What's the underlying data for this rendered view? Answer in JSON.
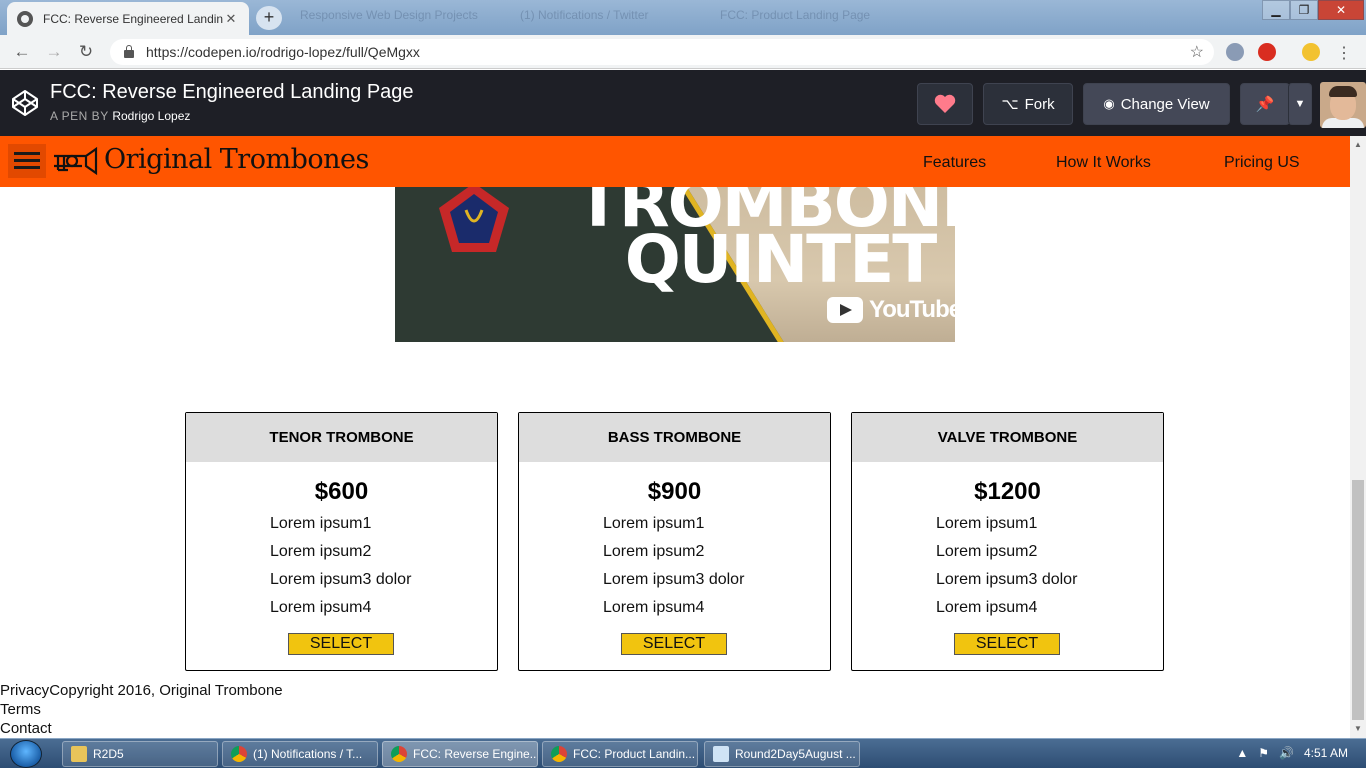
{
  "browser": {
    "active_tab_title": "FCC: Reverse Engineered Landing",
    "faded_tab_1": "Responsive Web Design Projects",
    "faded_tab_2": "(1) Notifications / Twitter",
    "faded_tab_3": "FCC: Product Landing Page",
    "url": "https://codepen.io/rodrigo-lopez/full/QeMgxx"
  },
  "codepen": {
    "pen_title": "FCC: Reverse Engineered Landing Page",
    "by_prefix": "A PEN BY",
    "author": "Rodrigo Lopez",
    "fork_label": "Fork",
    "change_view_label": "Change View"
  },
  "site": {
    "brand": "Original Trombones",
    "nav": [
      "Features",
      "How It Works",
      "Pricing US"
    ],
    "video": {
      "title_line1": "TROMBONE",
      "title_line2": "QUINTET",
      "platform": "YouTube"
    }
  },
  "pricing": [
    {
      "name": "TENOR TROMBONE",
      "price": "$600",
      "features": [
        "Lorem ipsum1",
        "Lorem ipsum2",
        "Lorem ipsum3 dolor",
        "Lorem ipsum4"
      ],
      "button": "SELECT"
    },
    {
      "name": "BASS TROMBONE",
      "price": "$900",
      "features": [
        "Lorem ipsum1",
        "Lorem ipsum2",
        "Lorem ipsum3 dolor",
        "Lorem ipsum4"
      ],
      "button": "SELECT"
    },
    {
      "name": "VALVE TROMBONE",
      "price": "$1200",
      "features": [
        "Lorem ipsum1",
        "Lorem ipsum2",
        "Lorem ipsum3 dolor",
        "Lorem ipsum4"
      ],
      "button": "SELECT"
    }
  ],
  "footer": {
    "privacy": "Privacy",
    "copyright": "Copyright 2016, Original Trombone",
    "terms": "Terms",
    "contact": "Contact"
  },
  "taskbar": {
    "items": [
      "R2D5",
      "(1) Notifications / T...",
      "FCC: Reverse Engine...",
      "FCC: Product Landin...",
      "Round2Day5August ..."
    ],
    "clock": "4:51 AM"
  },
  "colors": {
    "site_nav_bg": "#ff5500",
    "select_button": "#f1c40f",
    "codepen_bar": "#1e1f26",
    "heart": "#ff7b8b"
  },
  "icons": [
    "back-icon",
    "forward-icon",
    "reload-icon",
    "lock-icon",
    "star-icon",
    "codepen-logo-icon",
    "heart-icon",
    "fork-icon",
    "eye-icon",
    "pin-icon",
    "chevron-down-icon",
    "hamburger-icon",
    "trombone-logo-icon",
    "youtube-icon"
  ]
}
